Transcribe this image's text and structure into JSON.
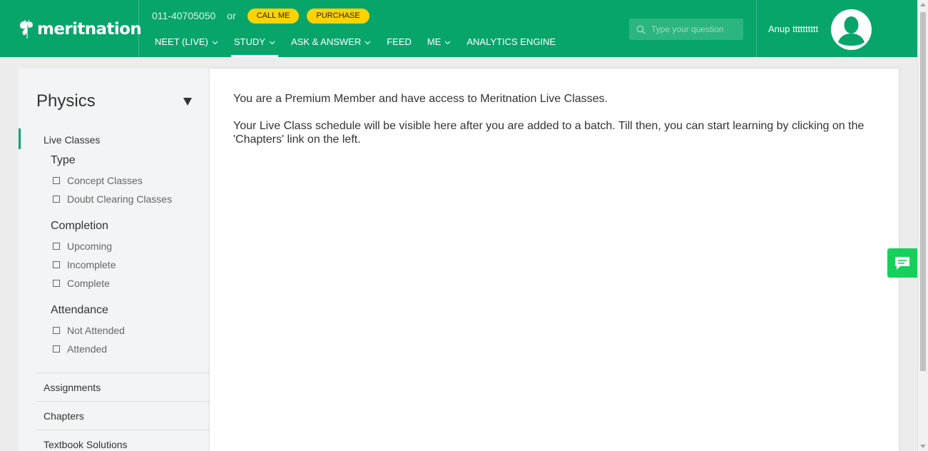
{
  "header": {
    "logo_text": "meritnation",
    "phone": "011-40705050",
    "or_text": "or",
    "call_me_label": "CALL ME",
    "purchase_label": "PURCHASE",
    "nav": [
      {
        "label": "NEET (LIVE)",
        "has_dropdown": true
      },
      {
        "label": "STUDY",
        "has_dropdown": true,
        "active": true
      },
      {
        "label": "ASK & ANSWER",
        "has_dropdown": true
      },
      {
        "label": "FEED",
        "has_dropdown": false
      },
      {
        "label": "ME",
        "has_dropdown": true
      },
      {
        "label": "ANALYTICS ENGINE",
        "has_dropdown": false
      }
    ],
    "search_placeholder": "Type your question",
    "username": "Anup tttttttttt",
    "brand_color": "#08a56b",
    "accent_color": "#ffd200"
  },
  "sidebar": {
    "subject": "Physics",
    "live_classes_label": "Live Classes",
    "type_title": "Type",
    "type_options": [
      "Concept Classes",
      "Doubt Clearing Classes"
    ],
    "completion_title": "Completion",
    "completion_options": [
      "Upcoming",
      "Incomplete",
      "Complete"
    ],
    "attendance_title": "Attendance",
    "attendance_options": [
      "Not Attended",
      "Attended"
    ],
    "links": [
      "Assignments",
      "Chapters",
      "Textbook Solutions"
    ]
  },
  "main": {
    "premium_message": "You are a Premium Member and have access to Meritnation Live Classes.",
    "schedule_message_line1": "Your Live Class schedule will be visible here after you are added to a batch. Till then, you can start learning by clicking on the",
    "schedule_message_line2": "'Chapters' link on the left."
  },
  "icons": {
    "search": "search-icon",
    "avatar": "user-avatar-icon",
    "chat": "chat-bubble-icon",
    "dropdown": "chevron-down-icon",
    "subject_caret": "caret-down-icon"
  }
}
